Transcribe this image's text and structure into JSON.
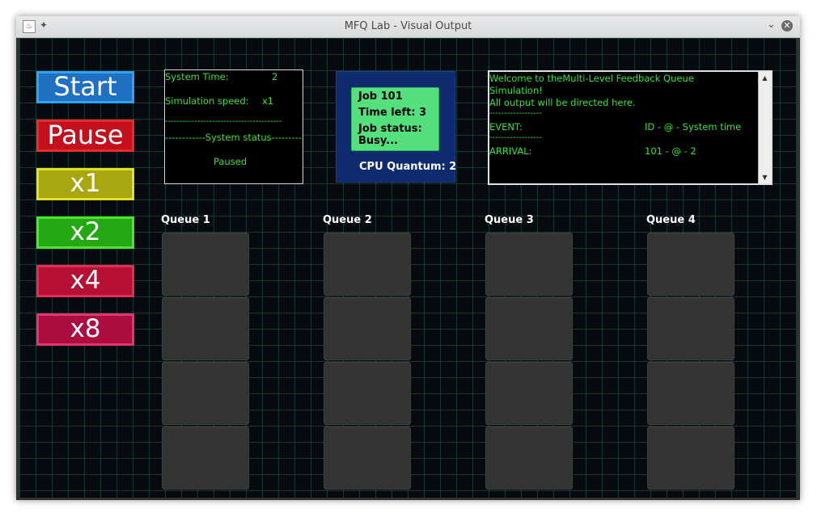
{
  "window": {
    "title": "MFQ Lab - Visual Output"
  },
  "controls": {
    "start": "Start",
    "pause": "Pause",
    "x1": "x1",
    "x2": "x2",
    "x4": "x4",
    "x8": "x8"
  },
  "system_panel": {
    "time_label": "System Time:",
    "time_value": "2",
    "speed_label": "Simulation speed:",
    "speed_value": "x1",
    "divider": "----------------------------------------",
    "status_header": "------------System status---------",
    "status_value": "Paused"
  },
  "cpu": {
    "job_title": "Job 101",
    "time_left": "Time left: 3",
    "status_label": "Job status:",
    "status_value": "Busy...",
    "quantum": "CPU Quantum: 2"
  },
  "log": {
    "line1": "Welcome to theMulti-Level Feedback Queue",
    "line2": "Simulation!",
    "line3": "All output will be directed here.",
    "sep1": "------------------",
    "event_label": "EVENT:",
    "event_header": "ID    - @ - System time",
    "sep2": "------------------",
    "arrival_label": "ARRIVAL:",
    "arrival_value": "101 - @ - 2"
  },
  "queues": [
    {
      "label": "Queue 1"
    },
    {
      "label": "Queue 2"
    },
    {
      "label": "Queue 3"
    },
    {
      "label": "Queue 4"
    }
  ],
  "colors": {
    "terminal_text": "#34e334",
    "start": "#1f6fc3",
    "pause": "#c3101c",
    "x1": "#a8a70f",
    "x2": "#24a913",
    "x4": "#b60f33",
    "x8": "#ad0c40",
    "job_card": "#55e07e",
    "cpu_box": "#0e2b6e"
  }
}
